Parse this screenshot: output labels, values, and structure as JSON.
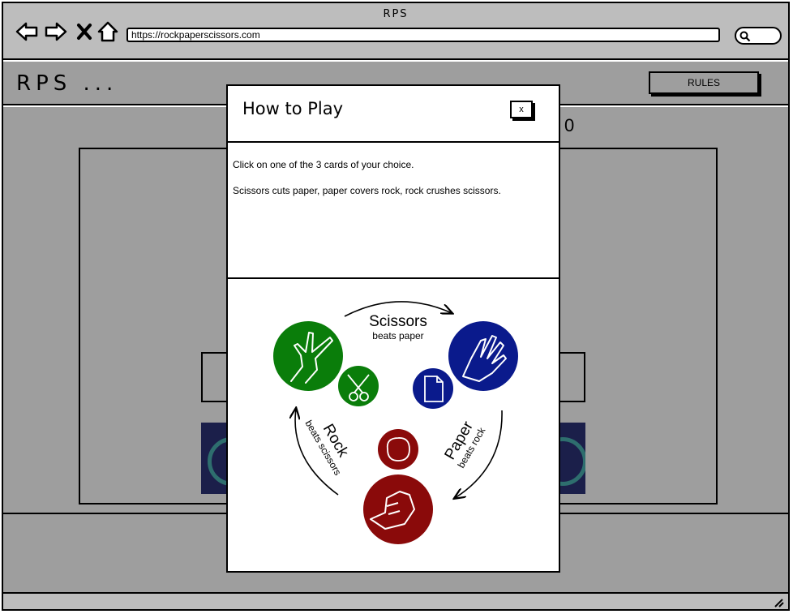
{
  "window": {
    "title": "RPS"
  },
  "browser": {
    "url": "https://rockpaperscissors.com"
  },
  "header": {
    "logo": "RPS ...",
    "rules_label": "RULES"
  },
  "game": {
    "score": "0"
  },
  "modal": {
    "title": "How to Play",
    "close_label": "x",
    "instructions": [
      "Click on one of the 3 cards of your choice.",
      "Scissors cuts paper, paper covers rock, rock crushes scissors."
    ],
    "diagram": {
      "scissors": {
        "name": "Scissors",
        "rule": "beats paper",
        "color": "#0a7d0a"
      },
      "paper": {
        "name": "Paper",
        "rule": "beats rock",
        "color": "#0a1a8c"
      },
      "rock": {
        "name": "Rock",
        "rule": "beats scissors",
        "color": "#8a0a0a"
      }
    }
  },
  "colors": {
    "chrome": "#bdbdbd",
    "app_bg": "#9e9e9e",
    "card_dark": "#1b1f4a"
  }
}
